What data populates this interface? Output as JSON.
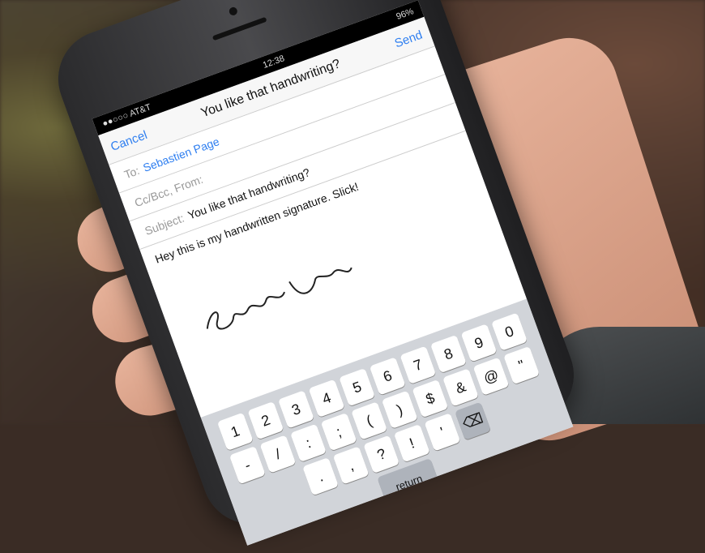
{
  "status": {
    "carrier": "●●○○○ AT&T",
    "time": "12:38",
    "battery": "96%"
  },
  "nav": {
    "cancel": "Cancel",
    "title": "You like that handwriting?",
    "send": "Send"
  },
  "to": {
    "label": "To:",
    "value": "Sebastien Page"
  },
  "ccbcc": {
    "label": "Cc/Bcc, From:"
  },
  "subject": {
    "label": "Subject:",
    "value": "You like that handwriting?"
  },
  "message": {
    "text": "Hey this is my handwritten signature. Slick!"
  },
  "keyboard": {
    "row1": [
      "1",
      "2",
      "3",
      "4",
      "5",
      "6",
      "7",
      "8",
      "9",
      "0"
    ],
    "row2": [
      "-",
      "/",
      ":",
      ";",
      "(",
      ")",
      "$",
      "&",
      "@",
      "\""
    ],
    "row3": [
      ".",
      ",",
      "?",
      "!",
      "'"
    ],
    "return_label": "return"
  },
  "colors": {
    "accent": "#2f7ff0"
  }
}
